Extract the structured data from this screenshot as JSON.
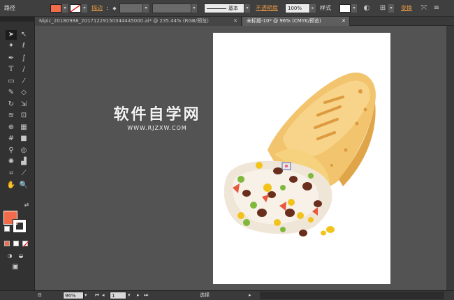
{
  "control_bar": {
    "object_type": "路径",
    "fill_color": "#f26b4a",
    "stroke_label": "描边",
    "stroke_colon": ":",
    "brush_definition": "基本",
    "opacity_label": "不透明度",
    "opacity_value": "100%",
    "style_label": "样式",
    "transform_label": "变换"
  },
  "tabs": [
    {
      "label": "Nipic_20180988_20171229150344445000.ai* @ 235.44% (RGB/预览)",
      "active": false
    },
    {
      "label": "未标题-10* @ 96% (CMYK/预览)",
      "active": true
    }
  ],
  "tools_panel": {
    "fill_color": "#f26b4a",
    "stroke_color": "#ffffff"
  },
  "watermark": {
    "title": "软件自学网",
    "url": "WWW.RJZXW.COM"
  },
  "status_bar": {
    "zoom": "96%",
    "artboard_number": "1",
    "tool_status": "选择"
  }
}
